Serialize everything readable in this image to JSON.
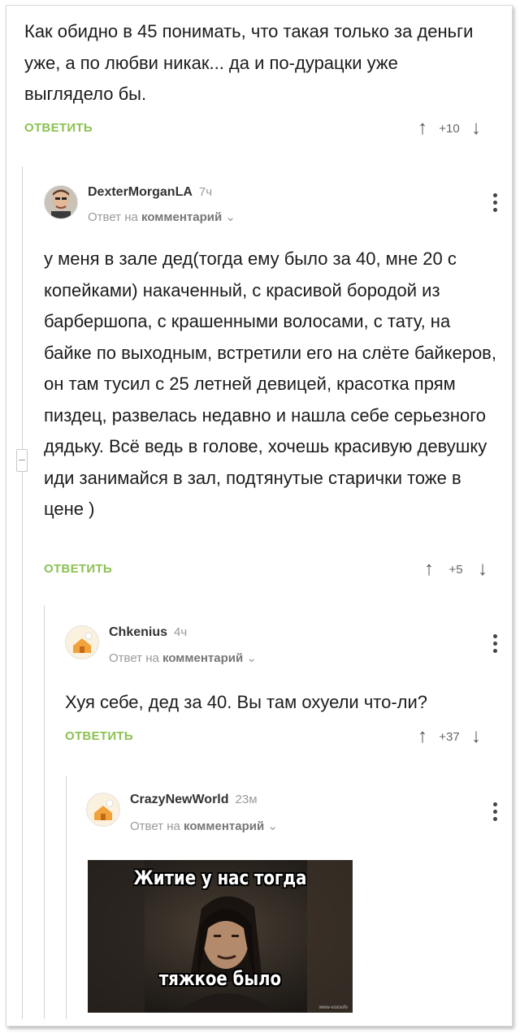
{
  "comments": [
    {
      "text": "Как обидно в 45 понимать, что такая только за деньги уже, а по любви никак... да и по-дурацки уже выглядело бы.",
      "reply_label": "ОТВЕТИТЬ",
      "score": "+10"
    },
    {
      "author": "DexterMorganLA",
      "time": "7ч",
      "meta_prefix": "Ответ на",
      "meta_link": "комментарий",
      "text": "у меня в зале дед(тогда ему было за 40, мне 20 с копейками) накаченный, с красивой бородой из барбершопа, с крашенными волосами, с тату, на байке по выходным, встретили его на слёте байкеров, он там тусил с 25 летней девицей, красотка прям пиздец, развелась недавно и нашла себе серьезного дядьку. Всё ведь в голове, хочешь красивую девушку иди занимайся в зал, подтянутые старички тоже в цене )",
      "reply_label": "ОТВЕТИТЬ",
      "score": "+5"
    },
    {
      "author": "Chkenius",
      "time": "4ч",
      "meta_prefix": "Ответ на",
      "meta_link": "комментарий",
      "text": "Хуя себе, дед за 40. Вы там охуели что-ли?",
      "reply_label": "ОТВЕТИТЬ",
      "score": "+37"
    },
    {
      "author": "CrazyNewWorld",
      "time": "23м",
      "meta_prefix": "Ответ на",
      "meta_link": "комментарий",
      "meme_top": "Житие у нас тогда",
      "meme_bottom": "тяжкое было",
      "meme_watermark": "www-voxsofv"
    }
  ],
  "icons": {
    "upvote": "arrow-up-icon",
    "downvote": "arrow-down-icon",
    "more": "more-vertical-icon",
    "dropdown": "chevron-down-icon",
    "collapse": "collapse-thread-icon"
  },
  "colors": {
    "reply": "#8cc152",
    "muted": "#9a9a9a",
    "thread_line": "#d5d5d5"
  }
}
